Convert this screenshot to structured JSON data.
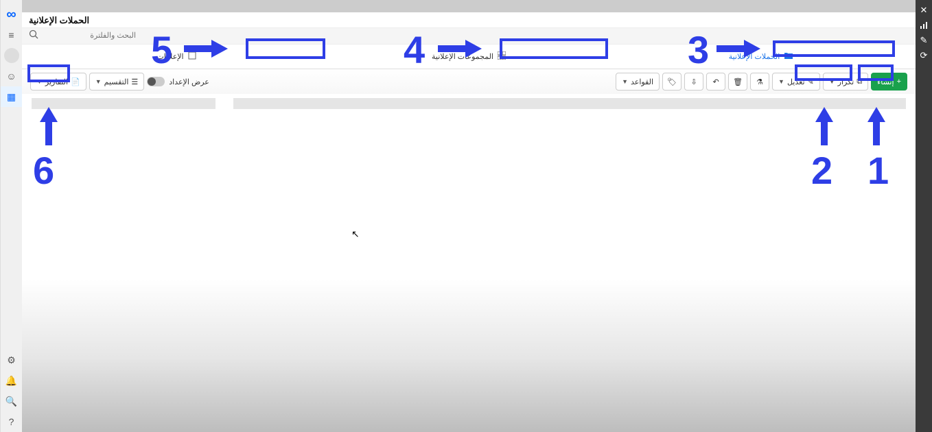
{
  "header": {
    "title": "الحملات الإعلانية"
  },
  "search": {
    "placeholder": "البحث والفلترة"
  },
  "tabs": {
    "campaigns": "الحملات الإعلانية",
    "adsets": "المجموعات الإعلانية",
    "ads": "الإعلانات"
  },
  "toolbar": {
    "create": "إنشاء",
    "duplicate": "تكرار",
    "edit": "تعديل",
    "rules": "القواعد",
    "presetup": "عرض الإعداد",
    "breakdown": "التقسيم",
    "reports": "التقارير"
  },
  "annotations": {
    "n1": "1",
    "n2": "2",
    "n3": "3",
    "n4": "4",
    "n5": "5",
    "n6": "6"
  }
}
